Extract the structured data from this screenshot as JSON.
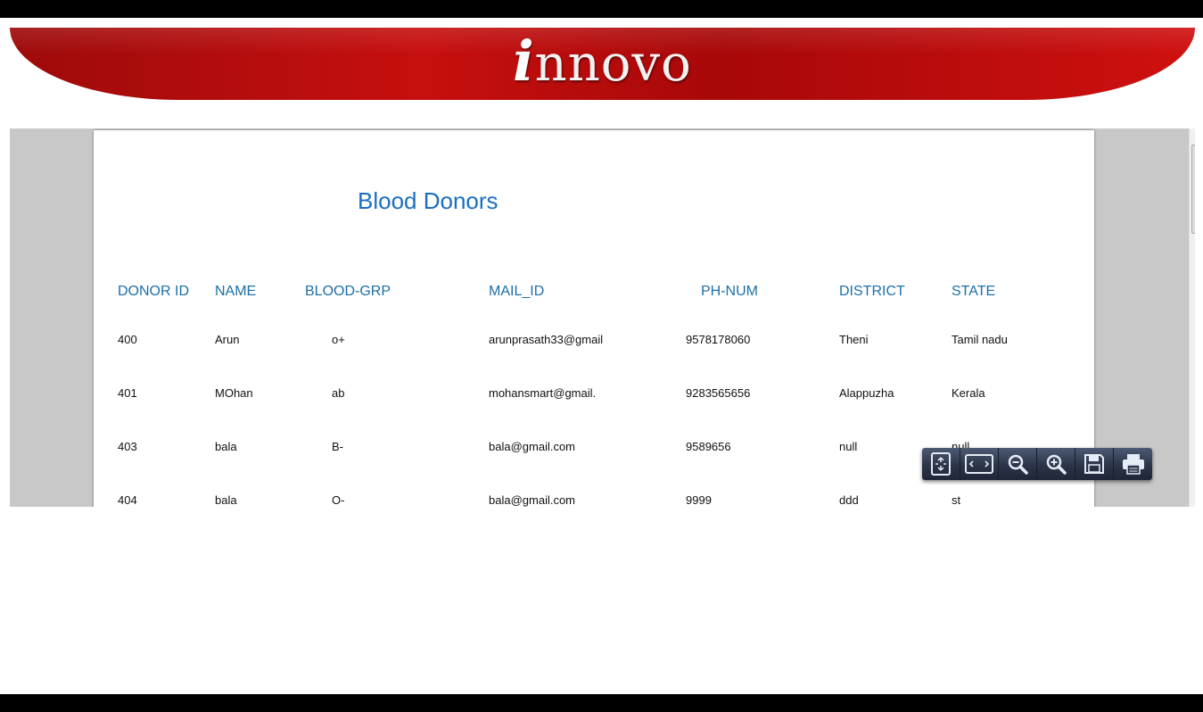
{
  "banner": {
    "logo_initial": "i",
    "logo_rest": "nnovo"
  },
  "report": {
    "title": "Blood Donors",
    "columns": [
      "DONOR ID",
      "NAME",
      "BLOOD-GRP",
      "MAIL_ID",
      "PH-NUM",
      "DISTRICT",
      "STATE"
    ],
    "rows": [
      [
        "400",
        "Arun",
        "o+",
        "arunprasath33@gmail",
        "9578178060",
        "Theni",
        "Tamil nadu"
      ],
      [
        "401",
        "MOhan",
        "ab",
        "mohansmart@gmail.",
        "9283565656",
        "Alappuzha",
        "Kerala"
      ],
      [
        "403",
        "bala",
        "B-",
        "bala@gmail.com",
        "9589656",
        "null",
        "null"
      ],
      [
        "404",
        "bala",
        "O-",
        "bala@gmail.com",
        "9999",
        "ddd",
        "st"
      ]
    ]
  },
  "toolbar": {
    "buttons": [
      "fit-page-icon",
      "fit-width-icon",
      "zoom-out-icon",
      "zoom-in-icon",
      "save-icon",
      "print-icon"
    ]
  },
  "colors": {
    "banner_red": "#c70f0f",
    "title_blue": "#1a6fc2",
    "header_blue": "#1b6fa8",
    "viewer_gray": "#c8c8c8",
    "toolbar_navy": "#2b3448"
  }
}
